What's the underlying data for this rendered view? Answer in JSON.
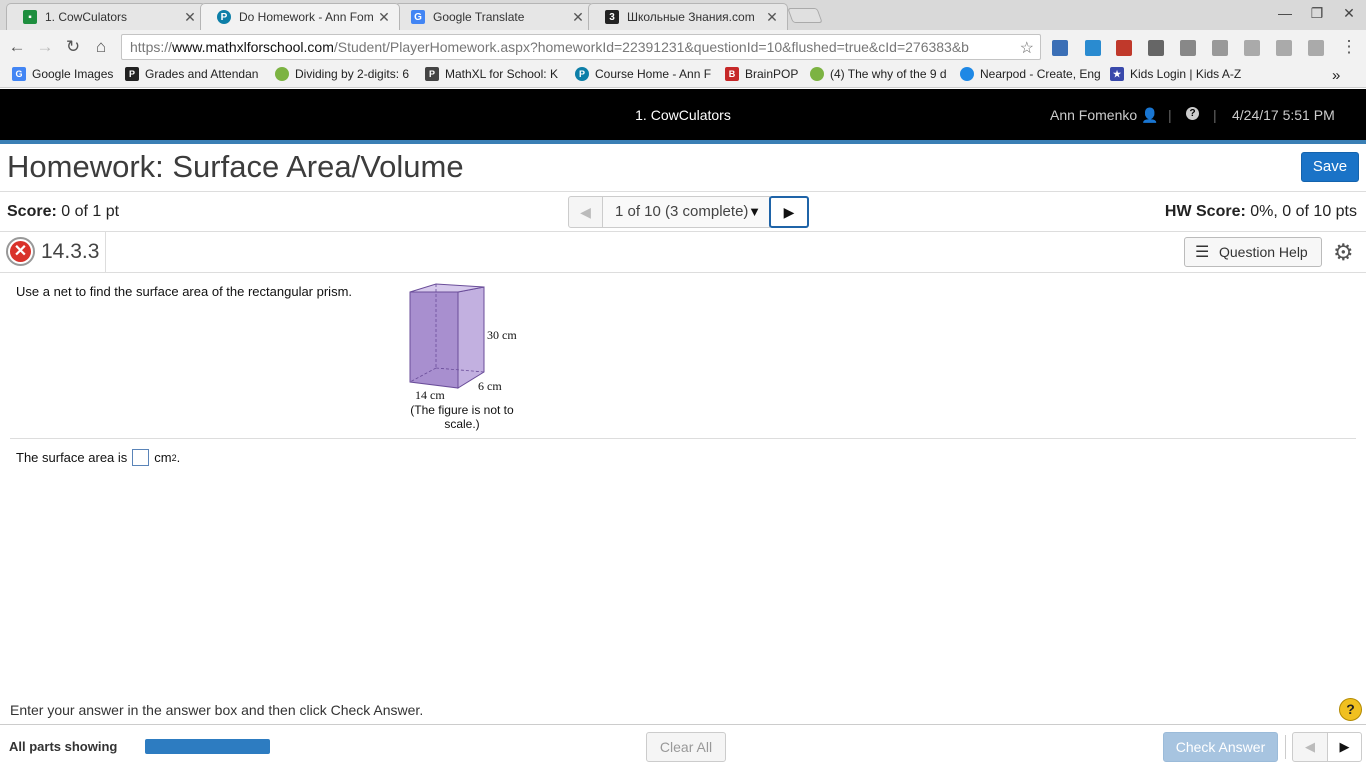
{
  "browser": {
    "tabs": [
      {
        "title": "1. CowCulators",
        "icon": "classroom-icon",
        "color": "#1e8e3e"
      },
      {
        "title": "Do Homework - Ann Fom",
        "icon": "pearson-icon",
        "color": "#0d7fa8"
      },
      {
        "title": "Google Translate",
        "icon": "translate-icon",
        "color": "#4285f4"
      },
      {
        "title": "Школьные Знания.com",
        "icon": "znania-icon",
        "color": "#222222"
      }
    ],
    "url_prefix": "https://",
    "url_host": "www.mathxlforschool.com",
    "url_path": "/Student/PlayerHomework.aspx?homeworkId=22391231&questionId=10&flushed=true&cId=276383&b",
    "bookmarks": [
      {
        "label": "Google Images",
        "icon": "google-icon",
        "color": "#4285f4"
      },
      {
        "label": "Grades and Attendan",
        "icon": "grades-icon",
        "color": "#222222"
      },
      {
        "label": "Dividing by 2-digits: 6",
        "icon": "leaf-icon",
        "color": "#7cb342"
      },
      {
        "label": "MathXL for School: K",
        "icon": "mathxl-icon",
        "color": "#444444"
      },
      {
        "label": "Course Home - Ann F",
        "icon": "pearson-icon",
        "color": "#0d7fa8"
      },
      {
        "label": "BrainPOP",
        "icon": "brainpop-icon",
        "color": "#c62828"
      },
      {
        "label": "(4) The why of the 9 d",
        "icon": "leaf-icon",
        "color": "#7cb342"
      },
      {
        "label": "Nearpod - Create, Eng",
        "icon": "nearpod-icon",
        "color": "#1e88e5"
      },
      {
        "label": "Kids Login | Kids A-Z",
        "icon": "kidsaz-icon",
        "color": "#3949ab"
      }
    ],
    "more_bookmarks": "»"
  },
  "header": {
    "course": "1. CowCulators",
    "user": "Ann Fomenko",
    "separator": "|",
    "help": "?",
    "datetime": "4/24/17 5:51 PM"
  },
  "homework": {
    "title": "Homework: Surface Area/Volume",
    "save_label": "Save",
    "score_label": "Score:",
    "score_value": "0 of 1 pt",
    "question_selector": "1 of 10 (3 complete)",
    "hw_score_label": "HW Score:",
    "hw_score_value": "0%, 0 of 10 pts",
    "question_number": "14.3.3",
    "question_help": "Question Help"
  },
  "question": {
    "instruction": "Use a net to find the surface area of the rectangular prism.",
    "figure": {
      "height_label": "30 cm",
      "width_label": "14 cm",
      "depth_label": "6 cm",
      "caption": "(The figure is not to scale.)",
      "fill_color": "#a88fcf"
    },
    "answer_prefix": "The surface area is",
    "answer_unit": "cm",
    "answer_unit_exp": "2",
    "answer_suffix": "."
  },
  "footer": {
    "instruction": "Enter your answer in the answer box and then click Check Answer.",
    "parts_showing": "All parts showing",
    "progress_fraction": 1.0,
    "clear_all": "Clear All",
    "check_answer": "Check Answer",
    "help_icon": "?"
  },
  "colors": {
    "accent": "#1a73c7",
    "error": "#d9322a",
    "header_bg": "#000000"
  }
}
